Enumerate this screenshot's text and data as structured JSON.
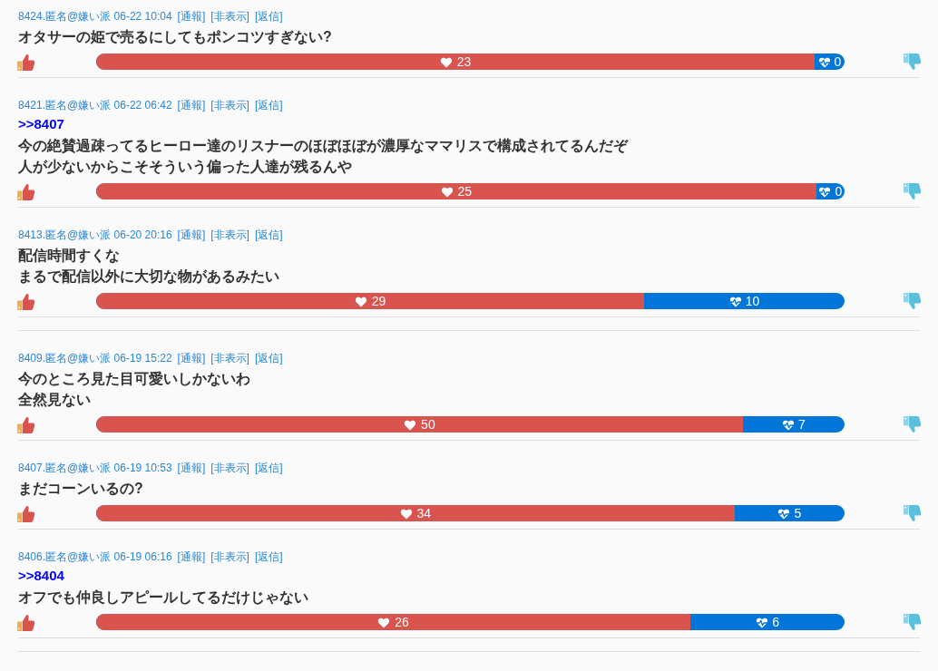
{
  "posts": [
    {
      "kind": "post",
      "meta": "8424.匿名@嫌い派 06-22 10:04",
      "actions": [
        "[通報]",
        "[非表示]",
        "[返信]"
      ],
      "lines": [
        "オタサーの姫で売るにしてもポンコツすぎない?"
      ],
      "likes": "23",
      "dislikes": "0",
      "level": 0.96
    },
    {
      "kind": "post",
      "meta": "8421.匿名@嫌い派 06-22 06:42",
      "actions": [
        "[通報]",
        "[非表示]",
        "[返信]"
      ],
      "reply_to": ">>8407",
      "lines": [
        "今の絶賛過疎ってるヒーロー達のリスナーのほぼほぼが濃厚なママリスで構成されてるんだぞ",
        "人が少ないからこそそういう偏った人達が残るんや"
      ],
      "likes": "25",
      "dislikes": "0",
      "level": 0.962
    },
    {
      "kind": "post",
      "meta": "8413.匿名@嫌い派 06-20 20:16",
      "actions": [
        "[通報]",
        "[非表示]",
        "[返信]"
      ],
      "lines": [
        "配信時間すくな",
        "まるで配信以外に大切な物があるみたい"
      ],
      "likes": "29",
      "dislikes": "10",
      "level": 0.732
    },
    {
      "kind": "divider"
    },
    {
      "kind": "post",
      "meta": "8409.匿名@嫌い派 06-19 15:22",
      "actions": [
        "[通報]",
        "[非表示]",
        "[返信]"
      ],
      "lines": [
        "今のところ見た目可愛いしかないわ",
        "全然見ない"
      ],
      "likes": "50",
      "dislikes": "7",
      "level": 0.864
    },
    {
      "kind": "post",
      "meta": "8407.匿名@嫌い派 06-19 10:53",
      "actions": [
        "[通報]",
        "[非表示]",
        "[返信]"
      ],
      "lines": [
        "まだコーンいるの?"
      ],
      "likes": "34",
      "dislikes": "5",
      "level": 0.853
    },
    {
      "kind": "post",
      "meta": "8406.匿名@嫌い派 06-19 06:16",
      "actions": [
        "[通報]",
        "[非表示]",
        "[返信]"
      ],
      "reply_to": ">>8404",
      "lines": [
        "オフでも仲良しアピールしてるだけじゃない"
      ],
      "likes": "26",
      "dislikes": "6",
      "level": 0.794
    },
    {
      "kind": "divider"
    }
  ]
}
